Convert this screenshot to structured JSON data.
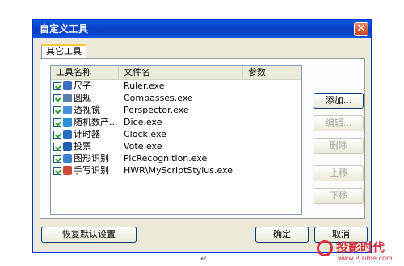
{
  "window": {
    "title": "自定义工具",
    "close_icon": "close-icon"
  },
  "tab": {
    "label": "其它工具"
  },
  "table": {
    "headers": [
      "工具名称",
      "文件名",
      "参数"
    ],
    "rows": [
      {
        "name": "尺子",
        "file": "Ruler.exe",
        "args": "",
        "checked": true,
        "icon": "ruler-icon",
        "color": "#3a6fc4"
      },
      {
        "name": "圆规",
        "file": "Compasses.exe",
        "args": "",
        "checked": true,
        "icon": "compass-icon",
        "color": "#5b7fa8"
      },
      {
        "name": "透视镜",
        "file": "Perspector.exe",
        "args": "",
        "checked": true,
        "icon": "magnifier-icon",
        "color": "#4a90d9"
      },
      {
        "name": "随机数产...",
        "file": "Dice.exe",
        "args": "",
        "checked": true,
        "icon": "dice-icon",
        "color": "#2f8fd6"
      },
      {
        "name": "计时器",
        "file": "Clock.exe",
        "args": "",
        "checked": true,
        "icon": "clock-icon",
        "color": "#2a6cc0"
      },
      {
        "name": "投票",
        "file": "Vote.exe",
        "args": "",
        "checked": true,
        "icon": "vote-icon",
        "color": "#1e5fa8"
      },
      {
        "name": "图形识别",
        "file": "PicRecognition.exe",
        "args": "",
        "checked": true,
        "icon": "shape-recognition-icon",
        "color": "#3f7fd0"
      },
      {
        "name": "手写识别",
        "file": "HWR\\MyScriptStylus.exe",
        "args": "",
        "checked": true,
        "icon": "handwriting-icon",
        "color": "#d04a3a"
      }
    ]
  },
  "buttons": {
    "add": "添加...",
    "edit": "编辑...",
    "delete": "删除",
    "move_up": "上移",
    "move_down": "下移",
    "restore": "恢复默认设置",
    "ok": "确定",
    "cancel": "取消"
  },
  "watermark": {
    "brand": "投影时代",
    "site": "www.PjTime.com"
  },
  "page_mark": "↵"
}
